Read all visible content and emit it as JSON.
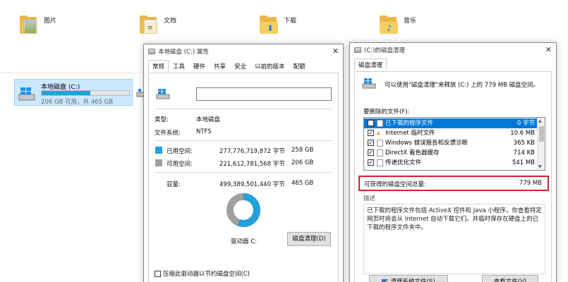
{
  "explorer": {
    "folders": [
      {
        "label": "图片",
        "icon": "picture-icon"
      },
      {
        "label": "文档",
        "icon": "document-icon"
      },
      {
        "label": "下载",
        "icon": "download-icon"
      },
      {
        "label": "音乐",
        "icon": "music-icon"
      }
    ],
    "drive": {
      "name": "本地磁盘 (C:)",
      "free_text": "206 GB 可用，共 465 GB",
      "used_fraction": 0.557
    }
  },
  "properties": {
    "title": "本地磁盘 (C:) 属性",
    "tabs": [
      "常规",
      "工具",
      "硬件",
      "共享",
      "安全",
      "以前的版本",
      "配额"
    ],
    "active_tab": "常规",
    "name_value": "",
    "type_label": "类型:",
    "type_value": "本地磁盘",
    "fs_label": "文件系统:",
    "fs_value": "NTFS",
    "used": {
      "label": "已用空间:",
      "bytes": "277,776,719,872 字节",
      "size": "258 GB",
      "color": "#26a0da"
    },
    "free": {
      "label": "可用空间:",
      "bytes": "221,612,781,568 字节",
      "size": "206 GB",
      "color": "#a0a0a0"
    },
    "capacity": {
      "label": "容量:",
      "bytes": "499,389,501,440 字节",
      "size": "465 GB"
    },
    "drive_label": "驱动器 C:",
    "cleanup_button": "磁盘清理(D)",
    "compress_label": "压缩此驱动器以节约磁盘空间(C)"
  },
  "cleanup": {
    "title": "(C:)的磁盘清理",
    "tab": "磁盘清理",
    "intro": "可以使用\"磁盘清理\"来释放 (C:) 上的 779 MB 磁盘空间。",
    "files_label": "要删除的文件(F):",
    "files": [
      {
        "name": "已下载的程序文件",
        "size": "0 字节",
        "checked": true,
        "selected": true
      },
      {
        "name": "Internet 临时文件",
        "size": "10.6 MB",
        "checked": true,
        "selected": false
      },
      {
        "name": "Windows 错误报告和反馈诊断",
        "size": "365 KB",
        "checked": true,
        "selected": false
      },
      {
        "name": "DirectX 着色器缓存",
        "size": "714 KB",
        "checked": true,
        "selected": false
      },
      {
        "name": "传递优化文件",
        "size": "541 MB",
        "checked": true,
        "selected": false
      }
    ],
    "total_label": "可获得的磁盘空间总量:",
    "total_value": "779 MB",
    "highlight_color": "#d0242b",
    "desc_label": "描述",
    "description": "已下载的程序文件包括 ActiveX 控件和 Java 小程序，你查看特定网页时将会从 Internet 自动下载它们。并临时保存在硬盘上的已下载的程序文件夹中。",
    "clean_system_button": "清理系统文件(S)",
    "view_files_button": "查看文件(V)"
  }
}
